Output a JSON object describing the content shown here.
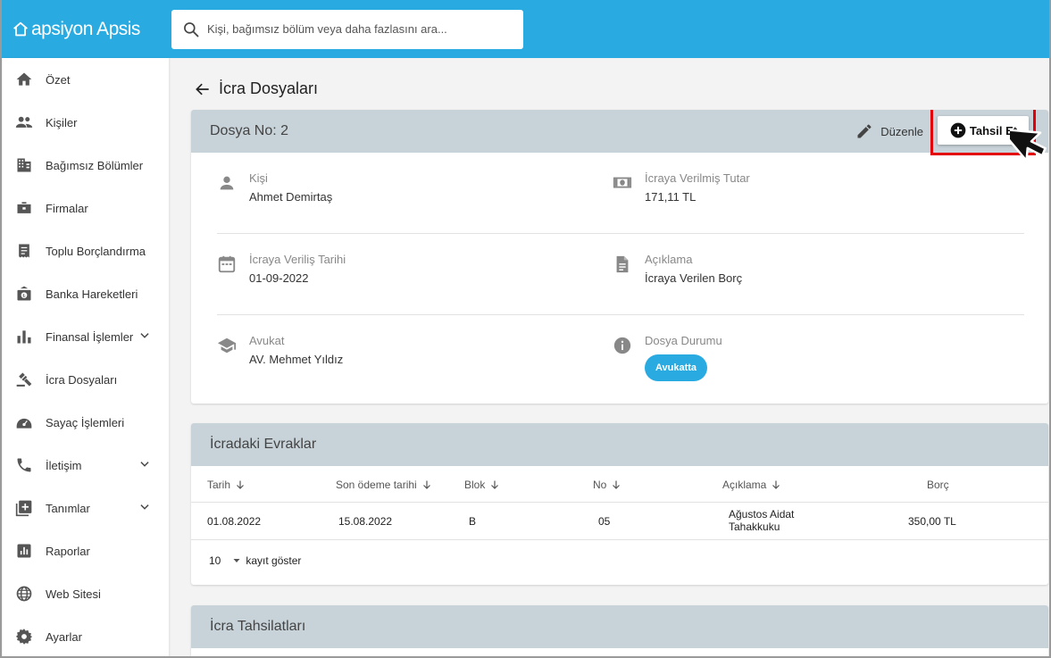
{
  "app": {
    "brand": "apsiyon Apsis"
  },
  "search": {
    "placeholder": "Kişi, bağımsız bölüm veya daha fazlasını ara..."
  },
  "sidebar": {
    "items": [
      {
        "label": "Özet",
        "icon": "home-icon"
      },
      {
        "label": "Kişiler",
        "icon": "people-icon"
      },
      {
        "label": "Bağımsız Bölümler",
        "icon": "building-icon"
      },
      {
        "label": "Firmalar",
        "icon": "briefcase-icon"
      },
      {
        "label": "Toplu Borçlandırma",
        "icon": "receipt-icon"
      },
      {
        "label": "Banka Hareketleri",
        "icon": "bank-icon"
      },
      {
        "label": "Finansal İşlemler",
        "icon": "bar-chart-icon"
      },
      {
        "label": "İcra Dosyaları",
        "icon": "gavel-icon"
      },
      {
        "label": "Sayaç İşlemleri",
        "icon": "meter-icon"
      },
      {
        "label": "İletişim",
        "icon": "phone-icon"
      },
      {
        "label": "Tanımlar",
        "icon": "add-box-icon"
      },
      {
        "label": "Raporlar",
        "icon": "report-icon"
      },
      {
        "label": "Web Sitesi",
        "icon": "globe-icon"
      },
      {
        "label": "Ayarlar",
        "icon": "settings-icon"
      }
    ]
  },
  "page": {
    "title": "İcra Dosyaları"
  },
  "file": {
    "header": "Dosya No: 2",
    "edit_label": "Düzenle",
    "collect_label": "Tahsil Et",
    "person_label": "Kişi",
    "person_value": "Ahmet Demirtaş",
    "amount_label": "İcraya Verilmiş Tutar",
    "amount_value": "171,11 TL",
    "date_label": "İcraya Veriliş Tarihi",
    "date_value": "01-09-2022",
    "desc_label": "Açıklama",
    "desc_value": "İcraya Verilen Borç",
    "lawyer_label": "Avukat",
    "lawyer_value": "AV. Mehmet Yıldız",
    "status_label": "Dosya Durumu",
    "status_value": "Avukatta"
  },
  "docs": {
    "title": "İcradaki Evraklar",
    "columns": [
      "Tarih",
      "Son ödeme tarihi",
      "Blok",
      "No",
      "Açıklama",
      "Borç"
    ],
    "rows": [
      {
        "date": "01.08.2022",
        "due": "15.08.2022",
        "block": "B",
        "no": "05",
        "desc_line1": "Ağustos Aidat",
        "desc_line2": "Tahakkuku",
        "debt": "350,00 TL"
      }
    ],
    "page_size": "10",
    "page_size_label": "kayıt göster"
  },
  "collections": {
    "title": "İcra Tahsilatları"
  },
  "colors": {
    "accent": "#29abe2",
    "card_header": "#c8d3d9",
    "highlight": "#e3000b"
  }
}
